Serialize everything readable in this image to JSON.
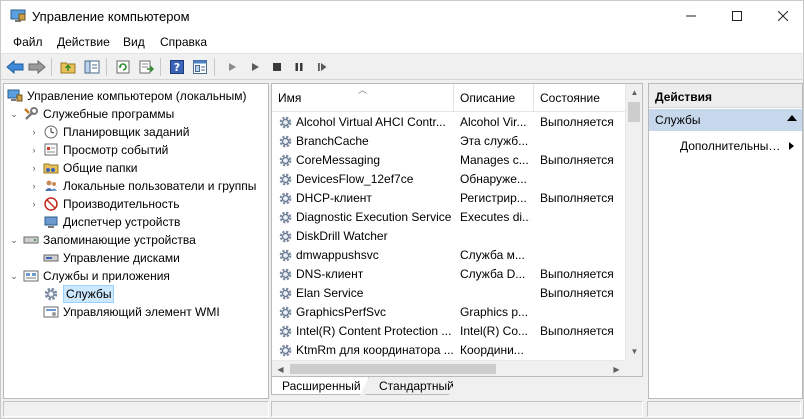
{
  "window": {
    "title": "Управление компьютером",
    "controls": {
      "minimize": "—",
      "maximize": "☐",
      "close": "✕"
    }
  },
  "menu": [
    "Файл",
    "Действие",
    "Вид",
    "Справка"
  ],
  "toolbar": {
    "icons": [
      "back-icon",
      "forward-icon",
      "up-folder-icon",
      "show-hide-tree-icon",
      "refresh-icon",
      "export-list-icon",
      "help-icon",
      "properties-icon",
      "start-service-icon",
      "stop-service-icon",
      "pause-service-icon",
      "restart-service-icon"
    ]
  },
  "tree": {
    "root": "Управление компьютером (локальным)",
    "nodes": [
      {
        "label": "Служебные программы"
      },
      {
        "label": "Планировщик заданий"
      },
      {
        "label": "Просмотр событий"
      },
      {
        "label": "Общие папки"
      },
      {
        "label": "Локальные пользователи и группы"
      },
      {
        "label": "Производительность"
      },
      {
        "label": "Диспетчер устройств"
      },
      {
        "label": "Запоминающие устройства"
      },
      {
        "label": "Управление дисками"
      },
      {
        "label": "Службы и приложения"
      },
      {
        "label": "Службы"
      },
      {
        "label": "Управляющий элемент WMI"
      }
    ]
  },
  "list": {
    "columns": {
      "name": "Имя",
      "description": "Описание",
      "state": "Состояние"
    },
    "rows": [
      {
        "name": "Alcohol Virtual AHCI Contr...",
        "description": "Alcohol Vir...",
        "state": "Выполняется"
      },
      {
        "name": "BranchCache",
        "description": "Эта служб...",
        "state": ""
      },
      {
        "name": "CoreMessaging",
        "description": "Manages c...",
        "state": "Выполняется"
      },
      {
        "name": "DevicesFlow_12ef7ce",
        "description": "Обнаруже...",
        "state": ""
      },
      {
        "name": "DHCP-клиент",
        "description": "Регистрир...",
        "state": "Выполняется"
      },
      {
        "name": "Diagnostic Execution Service",
        "description": "Executes di...",
        "state": ""
      },
      {
        "name": "DiskDrill Watcher",
        "description": "",
        "state": ""
      },
      {
        "name": "dmwappushsvc",
        "description": "Служба м...",
        "state": ""
      },
      {
        "name": "DNS-клиент",
        "description": "Служба D...",
        "state": "Выполняется"
      },
      {
        "name": "Elan Service",
        "description": "",
        "state": "Выполняется"
      },
      {
        "name": "GraphicsPerfSvc",
        "description": "Graphics p...",
        "state": ""
      },
      {
        "name": "Intel(R) Content Protection ...",
        "description": "Intel(R) Co...",
        "state": "Выполняется"
      },
      {
        "name": "KtmRm для координатора ...",
        "description": "Координи...",
        "state": ""
      }
    ]
  },
  "tabs": {
    "extended": "Расширенный",
    "standard": "Стандартный"
  },
  "actions": {
    "header": "Действия",
    "section": "Службы",
    "item": "Дополнительные действия"
  }
}
